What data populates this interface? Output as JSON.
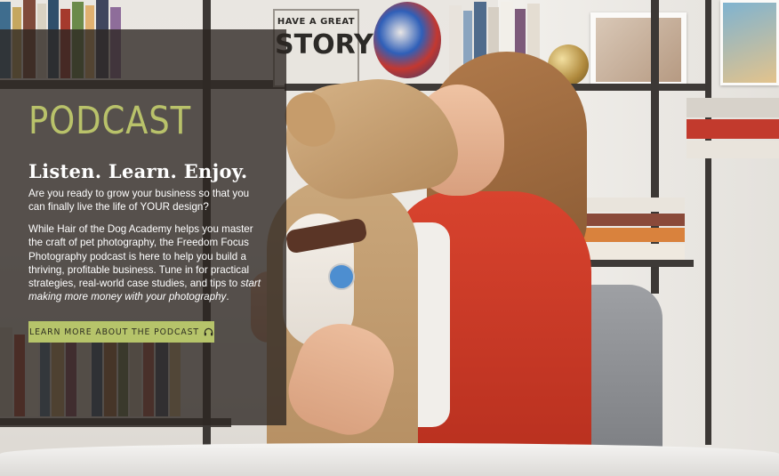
{
  "podcast_card": {
    "eyebrow": "PODCAST",
    "headline": "Listen. Learn. Enjoy.",
    "intro": "Are you ready to grow your business so that you can finally live the life of YOUR design?",
    "body_main": "While Hair of the Dog Academy helps you master the craft of pet photography, the Freedom Focus Photography podcast is here to help you build a thriving, profitable business. Tune in for practical strategies, real-world case studies, and tips to ",
    "body_emphasis": "start making more money with your photography",
    "body_end": ".",
    "cta_label": "LEARN MORE ABOUT THE PODCAST",
    "cta_icon": "headphones-icon"
  },
  "background_sign": {
    "line1": "HAVE A GREAT",
    "line2": "STORY"
  },
  "colors": {
    "accent_green": "#b6c46a",
    "overlay": "#2b2521",
    "jacket_red": "#c83a27"
  }
}
